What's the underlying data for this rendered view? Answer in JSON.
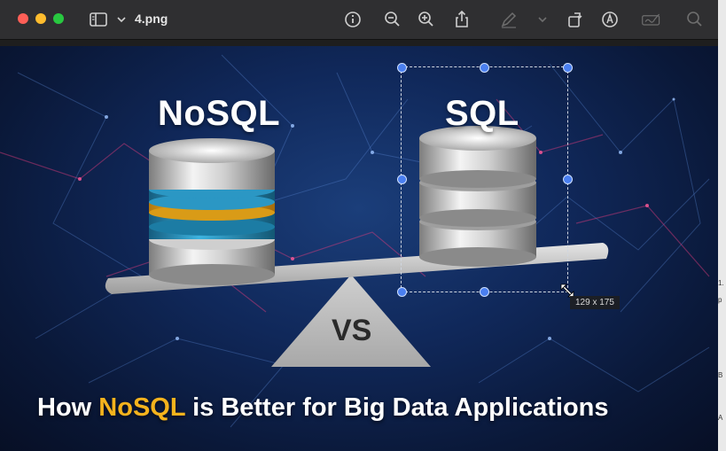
{
  "window": {
    "filename": "4.png",
    "toolbar_icons": [
      "sidebar-icon",
      "chevron-down-icon",
      "info-icon",
      "zoom-out-icon",
      "zoom-in-icon",
      "share-icon",
      "markup-pen-icon",
      "chevron-down-icon",
      "rotate-icon",
      "markup-icon",
      "signature-icon",
      "search-icon"
    ]
  },
  "image": {
    "left_title": "NoSQL",
    "right_title": "SQL",
    "vs_label": "VS",
    "caption_pre": "How ",
    "caption_accent": "NoSQL",
    "caption_post": " is Better for Big Data Applications",
    "accent_color": "#f5b31d"
  },
  "selection": {
    "size_label": "129 x 175"
  },
  "right_strip": {
    "fragments": [
      "1.",
      "p",
      "B",
      "A"
    ]
  }
}
